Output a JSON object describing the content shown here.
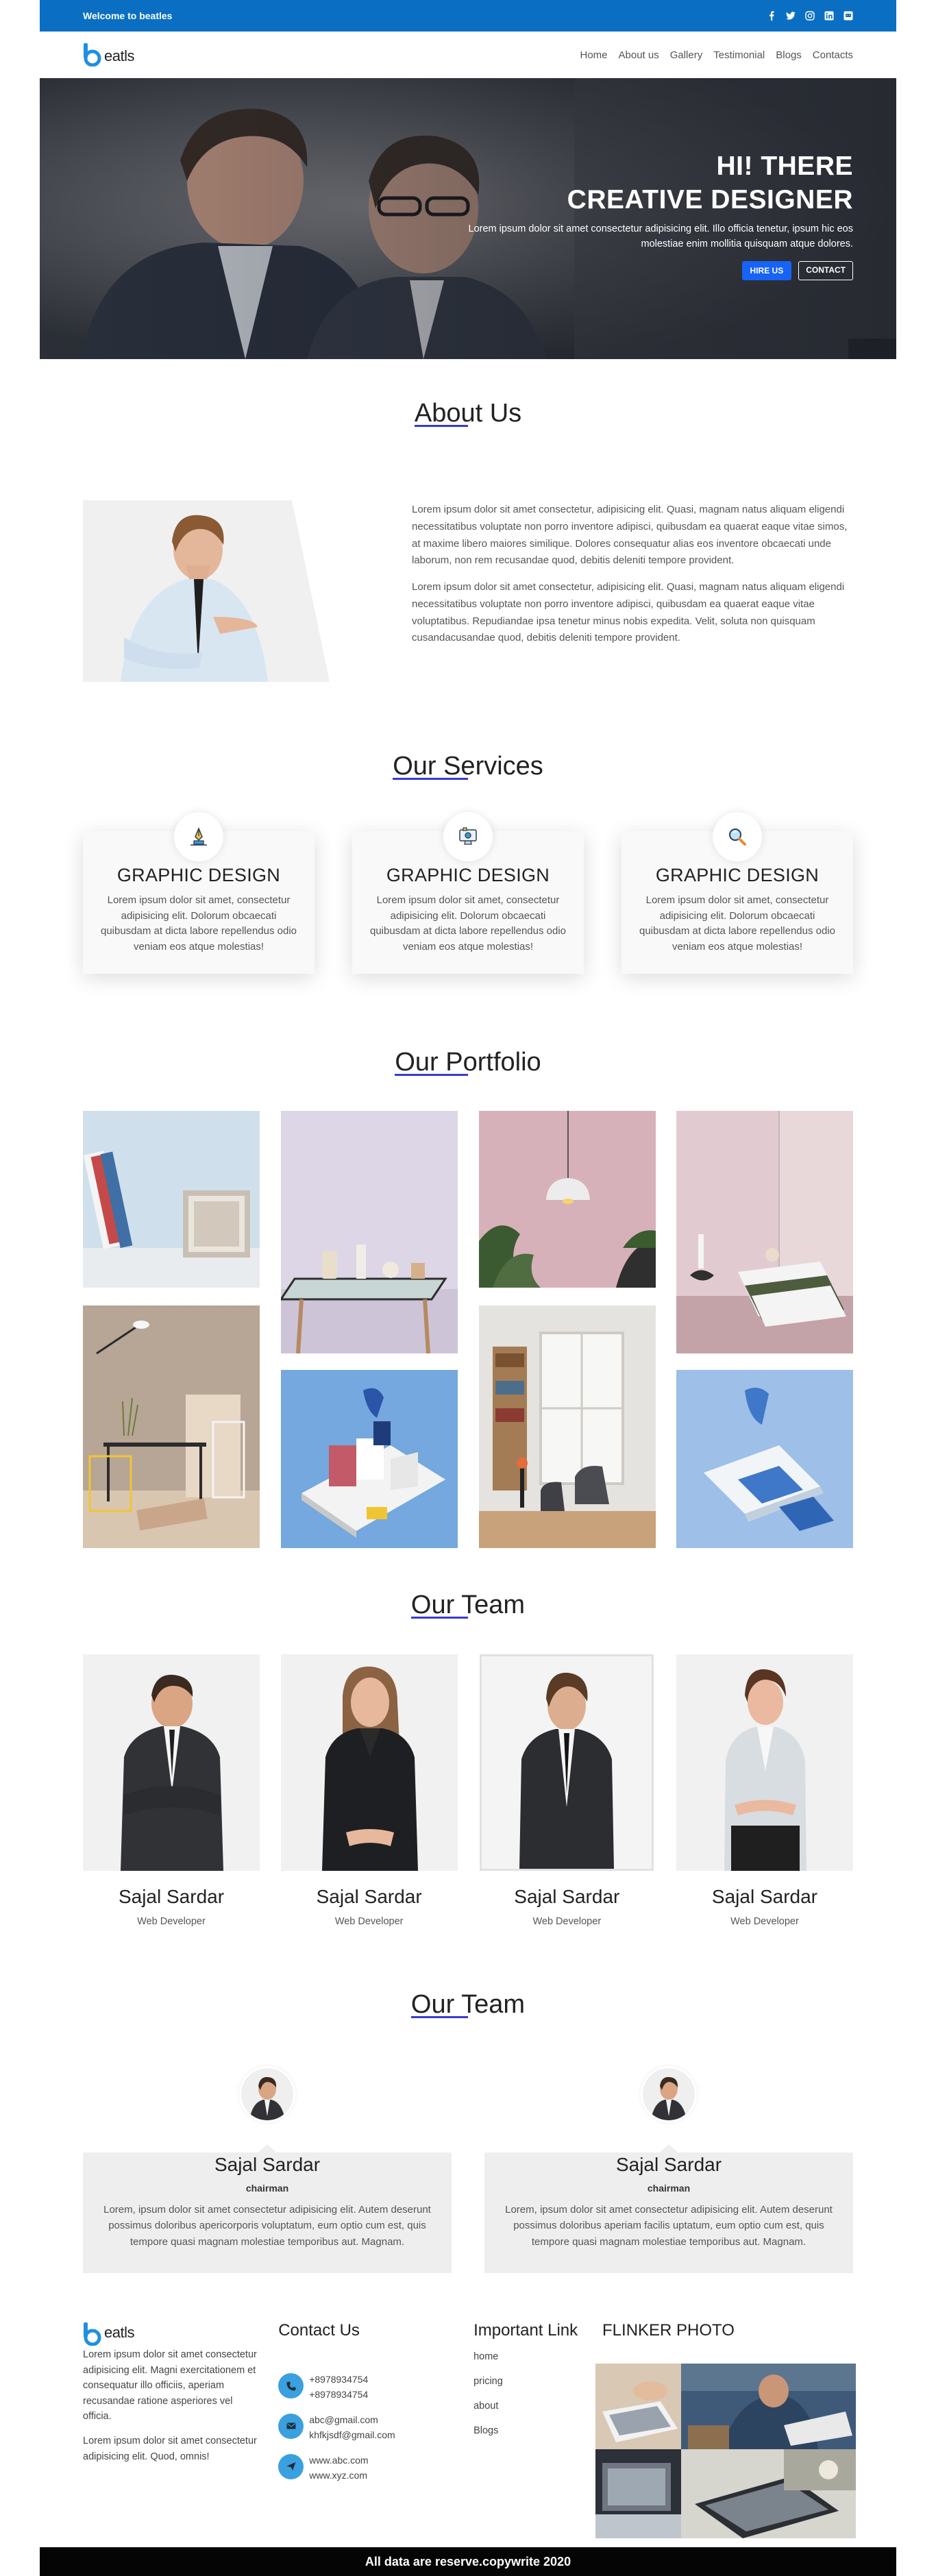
{
  "topbar": {
    "welcome": "Welcome to beatles",
    "socials": [
      "facebook-icon",
      "twitter-icon",
      "instagram-icon",
      "linkedin-icon",
      "chat-icon"
    ]
  },
  "nav": {
    "logo_text": "eatls",
    "items": [
      "Home",
      "About us",
      "Gallery",
      "Testimonial",
      "Blogs",
      "Contacts"
    ]
  },
  "hero": {
    "line1": "HI! THERE",
    "line2": "CREATIVE DESIGNER",
    "desc": "Lorem ipsum dolor sit amet consectetur adipisicing elit. Illo officia tenetur, ipsum hic eos molestiae enim mollitia quisquam atque dolores.",
    "hire_label": "HIRE US",
    "contact_label": "CONTACT"
  },
  "about": {
    "title": "About Us",
    "p1": "Lorem ipsum dolor sit amet consectetur, adipisicing elit. Quasi, magnam natus aliquam eligendi necessitatibus voluptate non porro inventore adipisci, quibusdam ea quaerat eaque vitae simos, at maxime libero maiores similique. Dolores consequatur alias eos inventore obcaecati unde laborum, non rem recusandae quod, debitis deleniti tempore provident.",
    "p2": "Lorem ipsum dolor sit amet consectetur, adipisicing elit. Quasi, magnam natus aliquam eligendi necessitatibus voluptate non porro inventore adipisci, quibusdam ea quaerat eaque vitae voluptatibus. Repudiandae ipsa tenetur minus nobis expedita. Velit, soluta non quisquam cusandacusandae quod, debitis deleniti tempore provident."
  },
  "services": {
    "title": "Our Services",
    "items": [
      {
        "icon": "pen-tool-icon",
        "title": "GRAPHIC DESIGN",
        "text": "Lorem ipsum dolor sit amet, consectetur adipisicing elit. Dolorum obcaecati quibusdam at dicta labore repellendus odio veniam eos atque molestias!"
      },
      {
        "icon": "monitor-icon",
        "title": "GRAPHIC DESIGN",
        "text": "Lorem ipsum dolor sit amet, consectetur adipisicing elit. Dolorum obcaecati quibusdam at dicta labore repellendus odio veniam eos atque molestias!"
      },
      {
        "icon": "magnifier-icon",
        "title": "GRAPHIC DESIGN",
        "text": "Lorem ipsum dolor sit amet, consectetur adipisicing elit. Dolorum obcaecati quibusdam at dicta labore repellendus odio veniam eos atque molestias!"
      }
    ]
  },
  "portfolio": {
    "title": "Our Portfolio"
  },
  "team": {
    "title": "Our Team",
    "members": [
      {
        "name": "Sajal Sardar",
        "role": "Web Developer"
      },
      {
        "name": "Sajal Sardar",
        "role": "Web Developer"
      },
      {
        "name": "Sajal Sardar",
        "role": "Web Developer"
      },
      {
        "name": "Sajal Sardar",
        "role": "Web Developer"
      }
    ]
  },
  "testimonials": {
    "title": "Our Team",
    "items": [
      {
        "name": "Sajal Sardar",
        "role": "chairman",
        "text": "Lorem, ipsum dolor sit amet consectetur adipisicing elit. Autem deserunt possimus doloribus apericorporis voluptatum, eum optio cum est, quis tempore quasi magnam molestiae temporibus aut. Magnam."
      },
      {
        "name": "Sajal Sardar",
        "role": "chairman",
        "text": "Lorem, ipsum dolor sit amet consectetur adipisicing elit. Autem deserunt possimus doloribus aperiam facilis uptatum, eum optio cum est, quis tempore quasi magnam molestiae temporibus aut. Magnam."
      }
    ]
  },
  "footer": {
    "about_p1": "Lorem ipsum dolor sit amet consectetur adipisicing elit. Magni exercitationem et consequatur illo officiis, aperiam recusandae ratione asperiores vel officia.",
    "about_p2": "Lorem ipsum dolor sit amet consectetur adipisicing elit. Quod, omnis!",
    "contact_title": "Contact Us",
    "phone1": "+8978934754",
    "phone2": "+8978934754",
    "email1": "abc@gmail.com",
    "email2": "khfkjsdf@gmail.com",
    "web1": "www.abc.com",
    "web2": "www.xyz.com",
    "links_title": "Important Link",
    "links": [
      "home",
      "pricing",
      "about",
      "Blogs"
    ],
    "photo_title": "FLINKER PHOTO",
    "copyright": "All data are reserve.copywrite 2020"
  },
  "colors": {
    "brand_blue": "#0a6fc2",
    "button_blue": "#1663f6",
    "heading_underline": "#3a3ad1",
    "contact_icon": "#3aa0df"
  }
}
